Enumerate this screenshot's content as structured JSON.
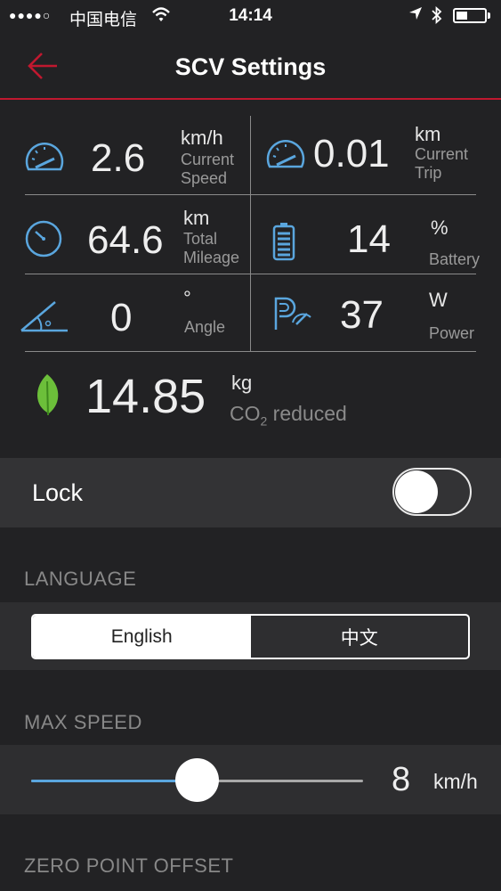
{
  "status_bar": {
    "signal": "●●●●○",
    "carrier": "中国电信",
    "time": "14:14"
  },
  "nav": {
    "title": "SCV Settings"
  },
  "stats": {
    "current_speed": {
      "value": "2.6",
      "unit": "km/h",
      "label1": "Current",
      "label2": "Speed"
    },
    "current_trip": {
      "value": "0.01",
      "unit": "km",
      "label1": "Current",
      "label2": "Trip"
    },
    "total_mileage": {
      "value": "64.6",
      "unit": "km",
      "label1": "Total",
      "label2": "Mileage"
    },
    "battery": {
      "value": "14",
      "unit": "%",
      "label": "Battery"
    },
    "angle": {
      "value": "0",
      "unit": "°",
      "label": "Angle"
    },
    "power": {
      "value": "37",
      "unit": "W",
      "label": "Power"
    },
    "co2": {
      "value": "14.85",
      "unit": "kg",
      "label_prefix": "CO",
      "label_sub": "2",
      "label_suffix": " reduced"
    }
  },
  "lock": {
    "label": "Lock",
    "enabled": false
  },
  "language": {
    "section": "LANGUAGE",
    "options": [
      "English",
      "中文"
    ],
    "selected": "English"
  },
  "max_speed": {
    "section": "MAX SPEED",
    "value": "8",
    "unit": "km/h",
    "slider_fraction": 0.5
  },
  "zero_point": {
    "section": "ZERO POINT OFFSET"
  },
  "colors": {
    "accent_red": "#c0182f",
    "icon_blue": "#5aa6de",
    "leaf_green": "#6cbf3a"
  }
}
